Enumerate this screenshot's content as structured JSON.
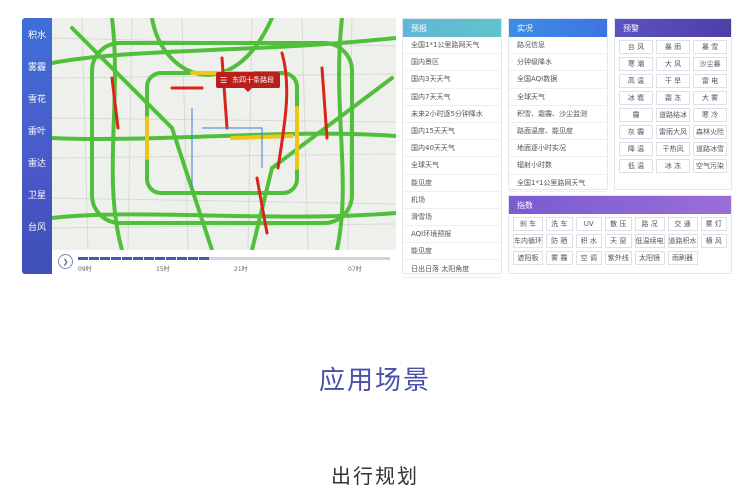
{
  "side_nav": [
    "积水",
    "雾霾",
    "雪花",
    "雷叶",
    "雷达",
    "卫星",
    "台风"
  ],
  "map": {
    "popup_label": "东四十条路段",
    "timeline_ticks": [
      "09时",
      "15时",
      "21时",
      "07时"
    ],
    "progress_fraction": 0.42
  },
  "forecast": {
    "title": "预报",
    "items": [
      "全国1*1公里路网天气",
      "国内景区",
      "国内3天天气",
      "国内7天天气",
      "未来2小时逐5分钟降水",
      "国内15天天气",
      "国内40天天气",
      "全球天气",
      "能见度",
      "机场",
      "滑雪场",
      "AQI环境预报",
      "能见度",
      "日出日落 太阳角度"
    ]
  },
  "realtime": {
    "title": "实况",
    "items": [
      "路况信息",
      "分钟级降水",
      "全国AQI数据",
      "全球天气",
      "积雪、霜霾、沙尘监测",
      "路面温度、能见度",
      "地面逐小时实况",
      "辐射小时数",
      "全国1*1公里路网天气"
    ]
  },
  "warning": {
    "title": "预警",
    "items": [
      "台 风",
      "暴 雨",
      "暴 雪",
      "寒 潮",
      "大 风",
      "沙尘暴",
      "高 温",
      "干 旱",
      "雷 电",
      "冰 雹",
      "霜 冻",
      "大 雾",
      "霾",
      "道路结冰",
      "寒 冷",
      "灰 霾",
      "雷雨大风",
      "森林火险",
      "降 温",
      "干热风",
      "道路冰雪",
      "低 温",
      "冰 冻",
      "空气污染"
    ]
  },
  "index": {
    "title": "指数",
    "items": [
      "刹 车",
      "洗 车",
      "UV",
      "散 压",
      "路 况",
      "交 通",
      "雾 灯",
      "车内循环",
      "防 晒",
      "积 水",
      "天 窗",
      "低温续电",
      "道路积水",
      "横 风",
      "遮阳板",
      "雾 霾",
      "空 调",
      "紫外线",
      "太阳镜",
      "雨刷器"
    ]
  },
  "section_title": "应用场景",
  "section_subtitle": "出行规划"
}
